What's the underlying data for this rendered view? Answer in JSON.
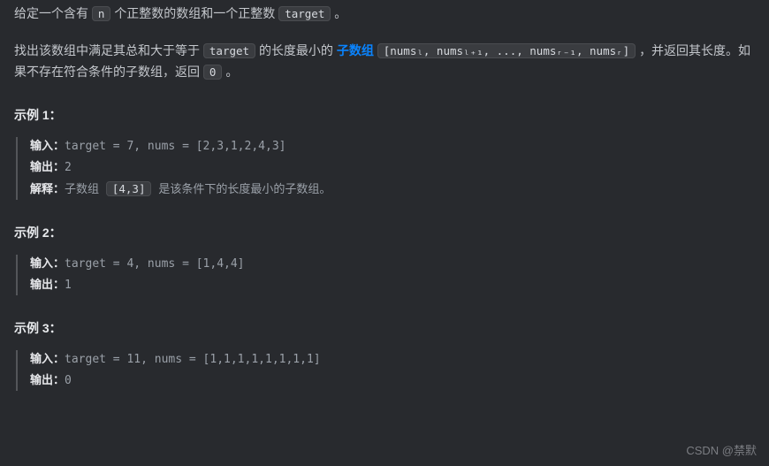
{
  "desc": {
    "p1_a": "给定一个含有 ",
    "p1_code1": "n",
    "p1_b": " 个正整数的数组和一个正整数 ",
    "p1_code2": "target",
    "p1_c": " 。",
    "p2_a": "找出该数组中满足其总和大于等于 ",
    "p2_code1": "target",
    "p2_b": " 的长度最小的 ",
    "p2_link": "子数组",
    "p2_code2": "[numsₗ, numsₗ₊₁, ..., numsᵣ₋₁, numsᵣ]",
    "p2_c": " ，并返回其长度。如果不存在符合条件的子数组，返回 ",
    "p2_code3": "0",
    "p2_d": " 。"
  },
  "labels": {
    "input": "输入：",
    "output": "输出：",
    "explain": "解释："
  },
  "examples": [
    {
      "title": "示例 1：",
      "input": "target = 7, nums = [2,3,1,2,4,3]",
      "output": "2",
      "explain_a": "子数组 ",
      "explain_code": "[4,3]",
      "explain_b": " 是该条件下的长度最小的子数组。"
    },
    {
      "title": "示例 2：",
      "input": "target = 4, nums = [1,4,4]",
      "output": "1"
    },
    {
      "title": "示例 3：",
      "input": "target = 11, nums = [1,1,1,1,1,1,1,1]",
      "output": "0"
    }
  ],
  "watermark": "CSDN @禁默"
}
